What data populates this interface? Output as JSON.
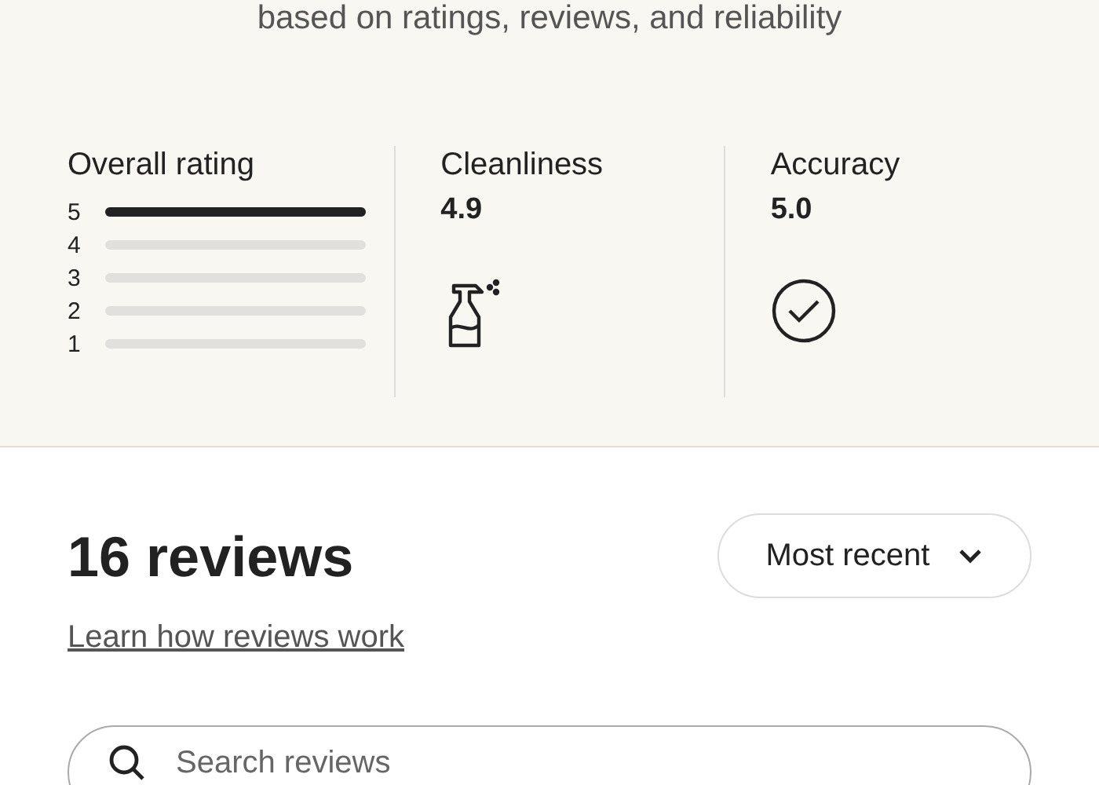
{
  "subtitle": "based on ratings, reviews, and reliability",
  "overall_rating": {
    "title": "Overall rating",
    "bars": [
      {
        "label": "5",
        "level": 1
      },
      {
        "label": "4",
        "level": 0
      },
      {
        "label": "3",
        "level": 0
      },
      {
        "label": "2",
        "level": 0
      },
      {
        "label": "1",
        "level": 0
      }
    ]
  },
  "categories": [
    {
      "name": "Cleanliness",
      "score": "4.9",
      "kind": "spray"
    },
    {
      "name": "Accuracy",
      "score": "5.0",
      "kind": "check"
    }
  ],
  "reviews": {
    "count": "16 reviews",
    "link": "Learn how reviews work",
    "sort": "Most recent"
  },
  "search": {
    "placeholder": "Search reviews"
  }
}
